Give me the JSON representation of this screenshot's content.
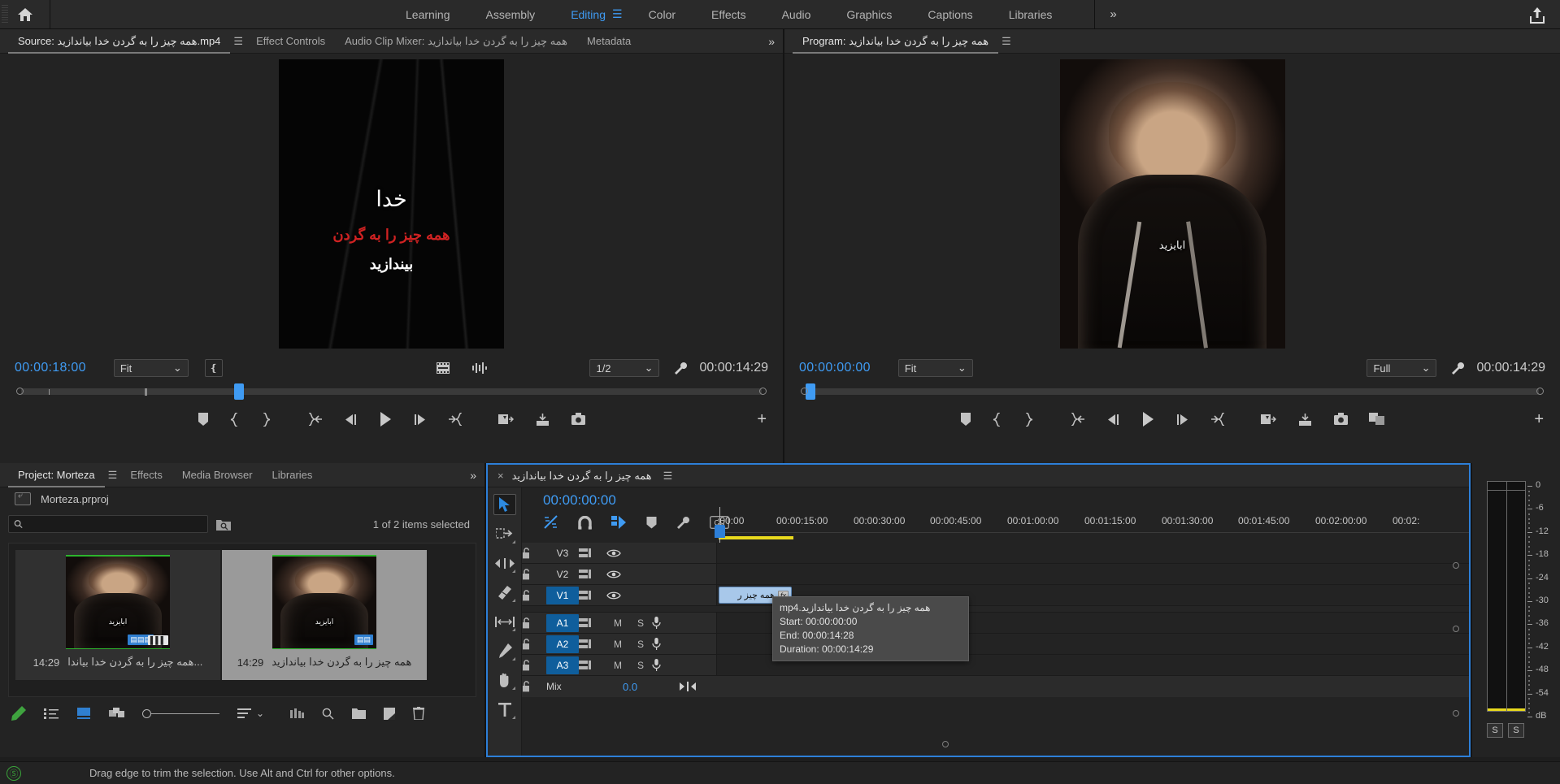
{
  "app": {
    "workspaces": [
      {
        "label": "Learning",
        "active": false
      },
      {
        "label": "Assembly",
        "active": false
      },
      {
        "label": "Editing",
        "active": true
      },
      {
        "label": "Color",
        "active": false
      },
      {
        "label": "Effects",
        "active": false
      },
      {
        "label": "Audio",
        "active": false
      },
      {
        "label": "Graphics",
        "active": false
      },
      {
        "label": "Captions",
        "active": false
      },
      {
        "label": "Libraries",
        "active": false
      }
    ],
    "more_label": "»",
    "home_icon": "home-icon",
    "share_icon": "share-export-icon",
    "accent_blue": "#3f9bf3",
    "selection_blue": "#2d7fd8"
  },
  "sequence_name": "همه چیز را به گردن خدا بیاندازید",
  "source_panel": {
    "tabs": [
      {
        "label": "Source: همه چیز را به گردن خدا بیاندازید.mp4",
        "active": true
      },
      {
        "label": "Effect Controls",
        "active": false
      },
      {
        "label": "Audio Clip Mixer: همه چیز را به گردن خدا بیاندازید",
        "active": false
      },
      {
        "label": "Metadata",
        "active": false
      }
    ],
    "overflow": "»",
    "playhead_timecode": "00:00:18:00",
    "fit_value": "Fit",
    "resolution_value": "1/2",
    "duration_timecode": "00:00:14:29",
    "frame_title": "خدا",
    "frame_sub_red": "همه چیز را به گردن",
    "frame_sub_white": "بیندازید"
  },
  "program_panel": {
    "tabs": [
      {
        "label": "Program: همه چیز را به گردن خدا بیاندازید",
        "active": true
      }
    ],
    "playhead_timecode": "00:00:00:00",
    "fit_value": "Fit",
    "resolution_value": "Full",
    "duration_timecode": "00:00:14:29",
    "frame_caption": "ابایزید"
  },
  "transport": {
    "source_buttons": [
      {
        "name": "add-marker-button",
        "glyph": "marker"
      },
      {
        "name": "mark-in-button",
        "glyph": "mark-in"
      },
      {
        "name": "mark-out-button",
        "glyph": "mark-out"
      },
      {
        "name": "go-to-in-button",
        "glyph": "go-in"
      },
      {
        "name": "step-back-button",
        "glyph": "step-back"
      },
      {
        "name": "play-stop-button",
        "glyph": "play"
      },
      {
        "name": "step-forward-button",
        "glyph": "step-fwd"
      },
      {
        "name": "go-to-out-button",
        "glyph": "go-out"
      },
      {
        "name": "insert-button",
        "glyph": "insert"
      },
      {
        "name": "overwrite-button",
        "glyph": "overwrite"
      },
      {
        "name": "export-frame-button",
        "glyph": "camera"
      }
    ],
    "program_extra": {
      "name": "comparison-view-button",
      "glyph": "compare"
    },
    "plus_label": "+"
  },
  "project_panel": {
    "tabs": [
      {
        "label": "Project: Morteza",
        "active": true
      },
      {
        "label": "Effects",
        "active": false
      },
      {
        "label": "Media Browser",
        "active": false
      },
      {
        "label": "Libraries",
        "active": false
      }
    ],
    "overflow": "»",
    "project_file": "Morteza.prproj",
    "search_placeholder": "",
    "search_value": "",
    "selection_status": "1 of 2 items selected",
    "items": [
      {
        "name": "...همه چیز را به گردن خدا بیاندا",
        "duration": "14:29",
        "selected": false,
        "badges": [
          "sequence-icon",
          "audio-waveform-icon"
        ]
      },
      {
        "name": "همه چیز را به گردن خدا بیاندازید",
        "duration": "14:29",
        "selected": true,
        "badges": [
          "sequence-icon"
        ]
      }
    ],
    "thumb_caption": "ابایزید",
    "toolbar": [
      {
        "name": "project-writable-button",
        "glyph": "pencil"
      },
      {
        "name": "list-view-button",
        "glyph": "list"
      },
      {
        "name": "icon-view-button",
        "glyph": "icon-grid"
      },
      {
        "name": "freeform-view-button",
        "glyph": "freeform"
      },
      {
        "name": "zoom-slider",
        "glyph": "slider"
      },
      {
        "name": "sort-icons-button",
        "glyph": "sort"
      },
      {
        "name": "automate-to-sequence-button",
        "glyph": "automate"
      },
      {
        "name": "find-button",
        "glyph": "magnifier"
      },
      {
        "name": "new-bin-button",
        "glyph": "folder"
      },
      {
        "name": "new-item-button",
        "glyph": "new-item"
      },
      {
        "name": "clear-button",
        "glyph": "trash"
      }
    ]
  },
  "timeline": {
    "tab_label": "همه چیز را به گردن خدا بیاندازید",
    "close_label": "×",
    "playhead_timecode": "00:00:00:00",
    "header_tools": [
      {
        "name": "nest-sequence-button",
        "glyph": "nest",
        "on": true
      },
      {
        "name": "snap-button",
        "glyph": "magnet",
        "on": false
      },
      {
        "name": "linked-selection-button",
        "glyph": "link-sel",
        "on": true
      },
      {
        "name": "add-marker-button",
        "glyph": "marker",
        "on": false
      },
      {
        "name": "timeline-settings-button",
        "glyph": "wrench",
        "on": false
      },
      {
        "name": "captions-button",
        "glyph": "cc",
        "on": false
      }
    ],
    "ruler_labels": [
      ":00:00",
      "00:00:15:00",
      "00:00:30:00",
      "00:00:45:00",
      "00:01:00:00",
      "00:01:15:00",
      "00:01:30:00",
      "00:01:45:00",
      "00:02:00:00",
      "00:02:"
    ],
    "tracks": [
      {
        "name": "V3",
        "type": "video",
        "targeted": false,
        "locked": false,
        "eye": true
      },
      {
        "name": "V2",
        "type": "video",
        "targeted": false,
        "locked": false,
        "eye": true
      },
      {
        "name": "V1",
        "type": "video",
        "targeted": true,
        "locked": false,
        "eye": true
      },
      {
        "name": "A1",
        "type": "audio",
        "targeted": true,
        "locked": false,
        "mute": "M",
        "solo": "S"
      },
      {
        "name": "A2",
        "type": "audio",
        "targeted": true,
        "locked": false,
        "mute": "M",
        "solo": "S"
      },
      {
        "name": "A3",
        "type": "audio",
        "targeted": true,
        "locked": false,
        "mute": "M",
        "solo": "S"
      }
    ],
    "mix_label": "Mix",
    "mix_value": "0.0",
    "clip_label": "همه چیز ر",
    "clip_fx_label": "fx"
  },
  "tooltip": {
    "title": "همه چیز را به گردن خدا بیاندازید.mp4",
    "start": "Start: 00:00:00:00",
    "end": "End: 00:00:14:28",
    "duration": "Duration: 00:00:14:29"
  },
  "audio_meters": {
    "scale_labels": [
      "0",
      "-6",
      "-12",
      "-18",
      "-24",
      "-30",
      "-36",
      "-42",
      "-48",
      "-54",
      "dB"
    ],
    "solo_left": "S",
    "solo_right": "S"
  },
  "status_bar": {
    "message": "Drag edge to trim the selection. Use Alt and Ctrl for other options.",
    "cc_icon": "creative-cloud-icon"
  }
}
